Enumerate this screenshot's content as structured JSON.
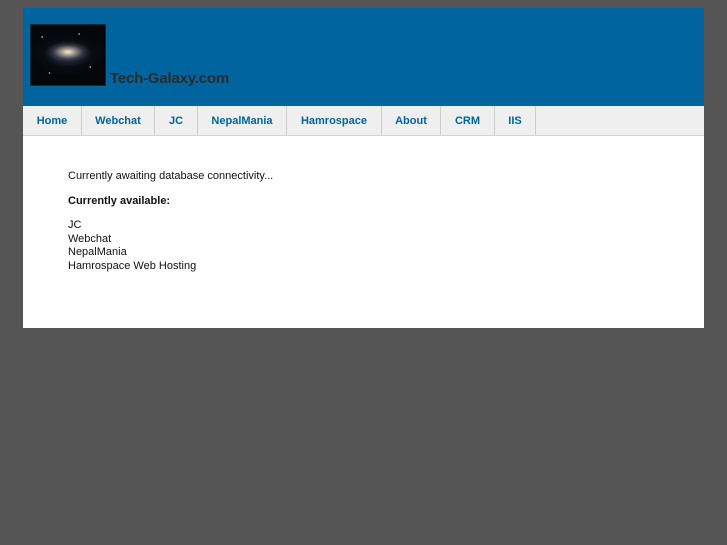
{
  "header": {
    "site_title": "Tech-Galaxy.com",
    "background_color": "#00659e",
    "logo_icon": "galaxy-image"
  },
  "nav": {
    "items": [
      {
        "label": "Home"
      },
      {
        "label": "Webchat"
      },
      {
        "label": "JC"
      },
      {
        "label": "NepalMania"
      },
      {
        "label": "Hamrospace"
      },
      {
        "label": "About"
      },
      {
        "label": "CRM"
      },
      {
        "label": "IIS"
      }
    ],
    "link_color": "#00659e"
  },
  "main": {
    "status_text": "Currently awaiting database connectivity...",
    "available_heading": "Currently available:",
    "available_items": [
      "JC",
      "Webchat",
      "NepalMania",
      "Hamrospace Web Hosting"
    ]
  }
}
